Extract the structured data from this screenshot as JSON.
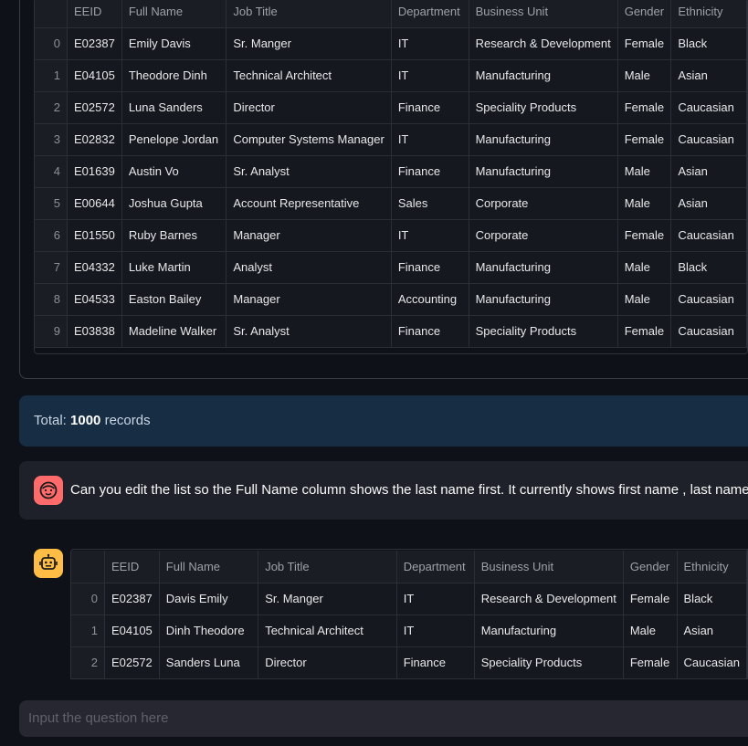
{
  "table": {
    "headers": [
      "",
      "EEID",
      "Full Name",
      "Job Title",
      "Department",
      "Business Unit",
      "Gender",
      "Ethnicity"
    ],
    "rows": [
      [
        "0",
        "E02387",
        "Emily Davis",
        "Sr. Manger",
        "IT",
        "Research & Development",
        "Female",
        "Black"
      ],
      [
        "1",
        "E04105",
        "Theodore Dinh",
        "Technical Architect",
        "IT",
        "Manufacturing",
        "Male",
        "Asian"
      ],
      [
        "2",
        "E02572",
        "Luna Sanders",
        "Director",
        "Finance",
        "Speciality Products",
        "Female",
        "Caucasian"
      ],
      [
        "3",
        "E02832",
        "Penelope Jordan",
        "Computer Systems Manager",
        "IT",
        "Manufacturing",
        "Female",
        "Caucasian"
      ],
      [
        "4",
        "E01639",
        "Austin Vo",
        "Sr. Analyst",
        "Finance",
        "Manufacturing",
        "Male",
        "Asian"
      ],
      [
        "5",
        "E00644",
        "Joshua Gupta",
        "Account Representative",
        "Sales",
        "Corporate",
        "Male",
        "Asian"
      ],
      [
        "6",
        "E01550",
        "Ruby Barnes",
        "Manager",
        "IT",
        "Corporate",
        "Female",
        "Caucasian"
      ],
      [
        "7",
        "E04332",
        "Luke Martin",
        "Analyst",
        "Finance",
        "Manufacturing",
        "Male",
        "Black"
      ],
      [
        "8",
        "E04533",
        "Easton Bailey",
        "Manager",
        "Accounting",
        "Manufacturing",
        "Male",
        "Caucasian"
      ],
      [
        "9",
        "E03838",
        "Madeline Walker",
        "Sr. Analyst",
        "Finance",
        "Speciality Products",
        "Female",
        "Caucasian"
      ]
    ]
  },
  "total": {
    "prefix": "Total: ",
    "count": "1000",
    "suffix": " records"
  },
  "user_message": {
    "avatar_icon": "smiley-face-icon",
    "text": "Can you edit the list so the Full Name column shows the last name first. It currently shows first name , last name"
  },
  "bot_response": {
    "avatar_icon": "robot-face-icon",
    "headers": [
      "",
      "EEID",
      "Full Name",
      "Job Title",
      "Department",
      "Business Unit",
      "Gender",
      "Ethnicity"
    ],
    "rows": [
      [
        "0",
        "E02387",
        "Davis Emily",
        "Sr. Manger",
        "IT",
        "Research & Development",
        "Female",
        "Black"
      ],
      [
        "1",
        "E04105",
        "Dinh Theodore",
        "Technical Architect",
        "IT",
        "Manufacturing",
        "Male",
        "Asian"
      ],
      [
        "2",
        "E02572",
        "Sanders Luna",
        "Director",
        "Finance",
        "Speciality Products",
        "Female",
        "Caucasian"
      ]
    ]
  },
  "input": {
    "placeholder": "Input the question here"
  },
  "colors": {
    "background": "#0e1117",
    "user_avatar": "#ff6b6b",
    "bot_avatar": "#ffbd45",
    "info_box": "#172d43"
  }
}
